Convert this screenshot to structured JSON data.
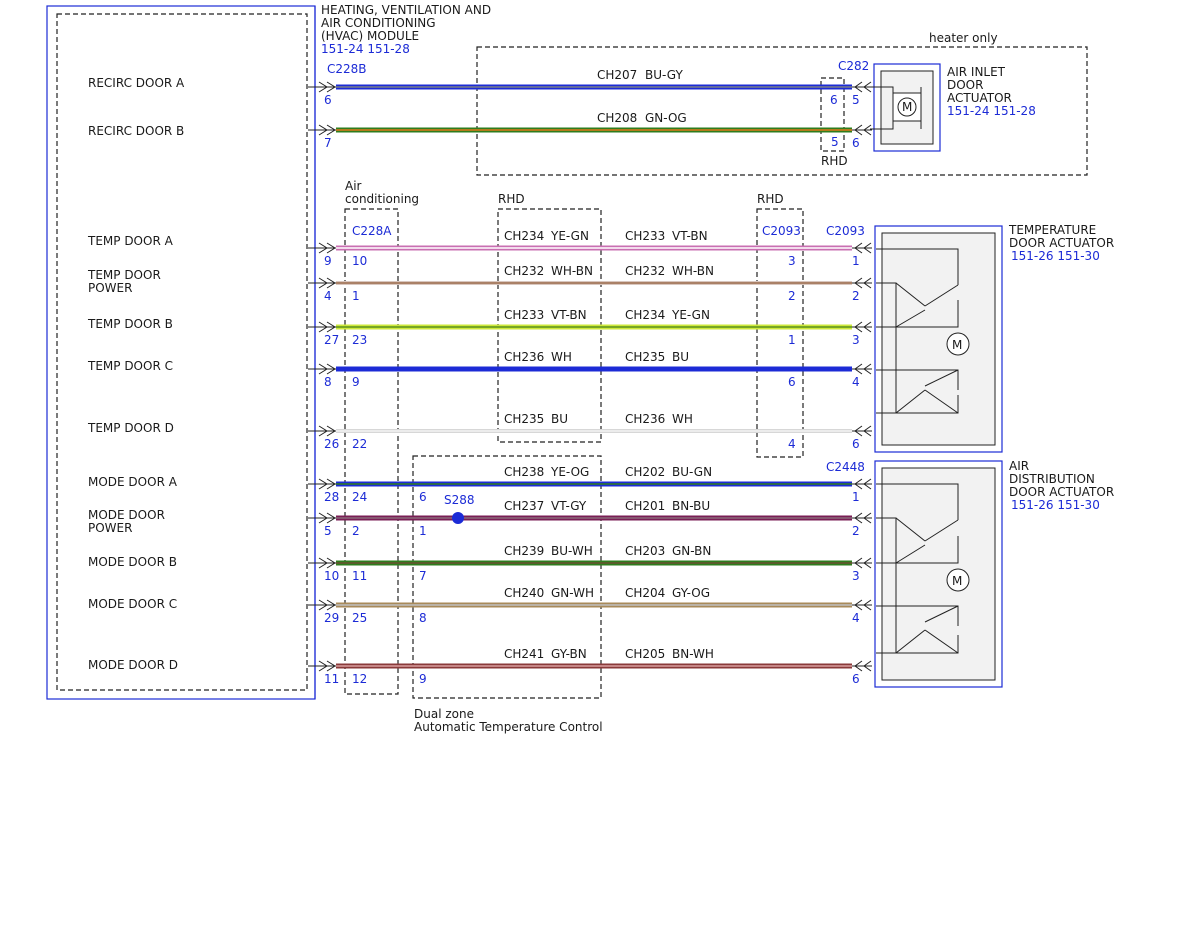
{
  "module": {
    "title_lines": [
      "HEATING, VENTILATION AND",
      "AIR CONDITIONING",
      "(HVAC) MODULE"
    ],
    "refs": "151-24  151-28",
    "connector": "C228B",
    "connector2": "C228A"
  },
  "signals": [
    {
      "name": "RECIRC DOOR A"
    },
    {
      "name": "RECIRC DOOR B"
    },
    {
      "name": "TEMP DOOR A"
    },
    {
      "name": "TEMP DOOR",
      "name2": "POWER"
    },
    {
      "name": "TEMP DOOR B"
    },
    {
      "name": "TEMP DOOR C"
    },
    {
      "name": "TEMP DOOR D"
    },
    {
      "name": "MODE DOOR A"
    },
    {
      "name": "MODE DOOR",
      "name2": "POWER"
    },
    {
      "name": "MODE DOOR B"
    },
    {
      "name": "MODE DOOR C"
    },
    {
      "name": "MODE DOOR D"
    }
  ],
  "wires": [
    {
      "pin_b": "6",
      "pin_a": "",
      "pin_dz": "",
      "left_circuit": "",
      "left_color": "",
      "right_circuit": "CH207",
      "right_color": "BU-GY",
      "end_pin": "5",
      "mid_pin": "6",
      "colors": [
        "#1c2bd6",
        "#7a8088"
      ]
    },
    {
      "pin_b": "7",
      "pin_a": "",
      "pin_dz": "",
      "left_circuit": "",
      "left_color": "",
      "right_circuit": "CH208",
      "right_color": "GN-OG",
      "end_pin": "6",
      "mid_pin": "",
      "colors": [
        "#2f7d1e",
        "#e07a1a"
      ]
    },
    {
      "pin_b": "9",
      "pin_a": "10",
      "pin_dz": "",
      "left_circuit": "CH234",
      "left_color": "YE-GN",
      "right_circuit": "CH233",
      "right_color": "VT-BN",
      "end_pin": "1",
      "mid_pin": "3",
      "colors": [
        "#c96fb2",
        "#ffffff"
      ]
    },
    {
      "pin_b": "4",
      "pin_a": "1",
      "pin_dz": "",
      "left_circuit": "CH232",
      "left_color": "WH-BN",
      "right_circuit": "CH232",
      "right_color": "WH-BN",
      "end_pin": "2",
      "mid_pin": "2",
      "colors": [
        "#d9c7bf",
        "#9a6a4a"
      ]
    },
    {
      "pin_b": "27",
      "pin_a": "23",
      "pin_dz": "",
      "left_circuit": "CH233",
      "left_color": "VT-BN",
      "right_circuit": "CH234",
      "right_color": "YE-GN",
      "end_pin": "3",
      "mid_pin": "1",
      "colors": [
        "#cde83a",
        "#5b8f1c"
      ]
    },
    {
      "pin_b": "8",
      "pin_a": "9",
      "pin_dz": "",
      "left_circuit": "CH236",
      "left_color": "WH",
      "right_circuit": "CH235",
      "right_color": "BU",
      "end_pin": "4",
      "mid_pin": "6",
      "colors": [
        "#1c2bd6",
        "#1c2bd6"
      ]
    },
    {
      "pin_b": "26",
      "pin_a": "22",
      "pin_dz": "",
      "left_circuit": "CH235",
      "left_color": "BU",
      "right_circuit": "CH236",
      "right_color": "WH",
      "end_pin": "6",
      "mid_pin": "4",
      "colors": [
        "#d7d7d7",
        "#f4f4f4"
      ]
    },
    {
      "pin_b": "28",
      "pin_a": "24",
      "pin_dz": "6",
      "left_circuit": "CH238",
      "left_color": "YE-OG",
      "right_circuit": "CH202",
      "right_color": "BU-GN",
      "end_pin": "1",
      "mid_pin": "",
      "colors": [
        "#1c2bd6",
        "#2f7d1e"
      ]
    },
    {
      "pin_b": "5",
      "pin_a": "2",
      "pin_dz": "1",
      "left_circuit": "CH237",
      "left_color": "VT-GY",
      "right_circuit": "CH201",
      "right_color": "BN-BU",
      "end_pin": "2",
      "mid_pin": "",
      "colors": [
        "#7a1e55",
        "#8a6a7a"
      ]
    },
    {
      "pin_b": "10",
      "pin_a": "11",
      "pin_dz": "7",
      "left_circuit": "CH239",
      "left_color": "BU-WH",
      "right_circuit": "CH203",
      "right_color": "GN-BN",
      "end_pin": "3",
      "mid_pin": "",
      "colors": [
        "#2f7d1e",
        "#6a5030"
      ]
    },
    {
      "pin_b": "29",
      "pin_a": "25",
      "pin_dz": "8",
      "left_circuit": "CH240",
      "left_color": "GN-WH",
      "right_circuit": "CH204",
      "right_color": "GY-OG",
      "end_pin": "4",
      "mid_pin": "",
      "colors": [
        "#a88a5a",
        "#c0c0c0"
      ]
    },
    {
      "pin_b": "11",
      "pin_a": "12",
      "pin_dz": "9",
      "left_circuit": "CH241",
      "left_color": "GY-BN",
      "right_circuit": "CH205",
      "right_color": "BN-WH",
      "end_pin": "6",
      "mid_pin": "",
      "colors": [
        "#8a3a3a",
        "#d9a0a0"
      ]
    }
  ],
  "boxes": {
    "heater_only": "heater only",
    "rhd_left": "RHD",
    "rhd_right": "RHD",
    "rhd_c282": "RHD",
    "mid_pin_extra": "5",
    "aircon_lines": [
      "Air",
      "conditioning"
    ],
    "dualzone_lines": [
      "Dual zone",
      "Automatic Temperature Control"
    ],
    "splice": "S288"
  },
  "connectors": {
    "c282": "C282",
    "c2093_mid": "C2093",
    "c2093_end": "C2093",
    "c2448": "C2448"
  },
  "actuators": {
    "air_inlet": {
      "lines": [
        "AIR INLET",
        "DOOR",
        "ACTUATOR"
      ],
      "refs": "151-24  151-28"
    },
    "temperature": {
      "lines": [
        "TEMPERATURE",
        "DOOR ACTUATOR"
      ],
      "refs": "151-26  151-30"
    },
    "air_distribution": {
      "lines": [
        "AIR",
        "DISTRIBUTION",
        "DOOR ACTUATOR"
      ],
      "refs": "151-26  151-30"
    },
    "motor_symbol": "M"
  },
  "colors": {
    "connector_text": "#1c2bd6",
    "module_border": "#1c2bd6",
    "actuator_fill": "#f2f2f2"
  }
}
